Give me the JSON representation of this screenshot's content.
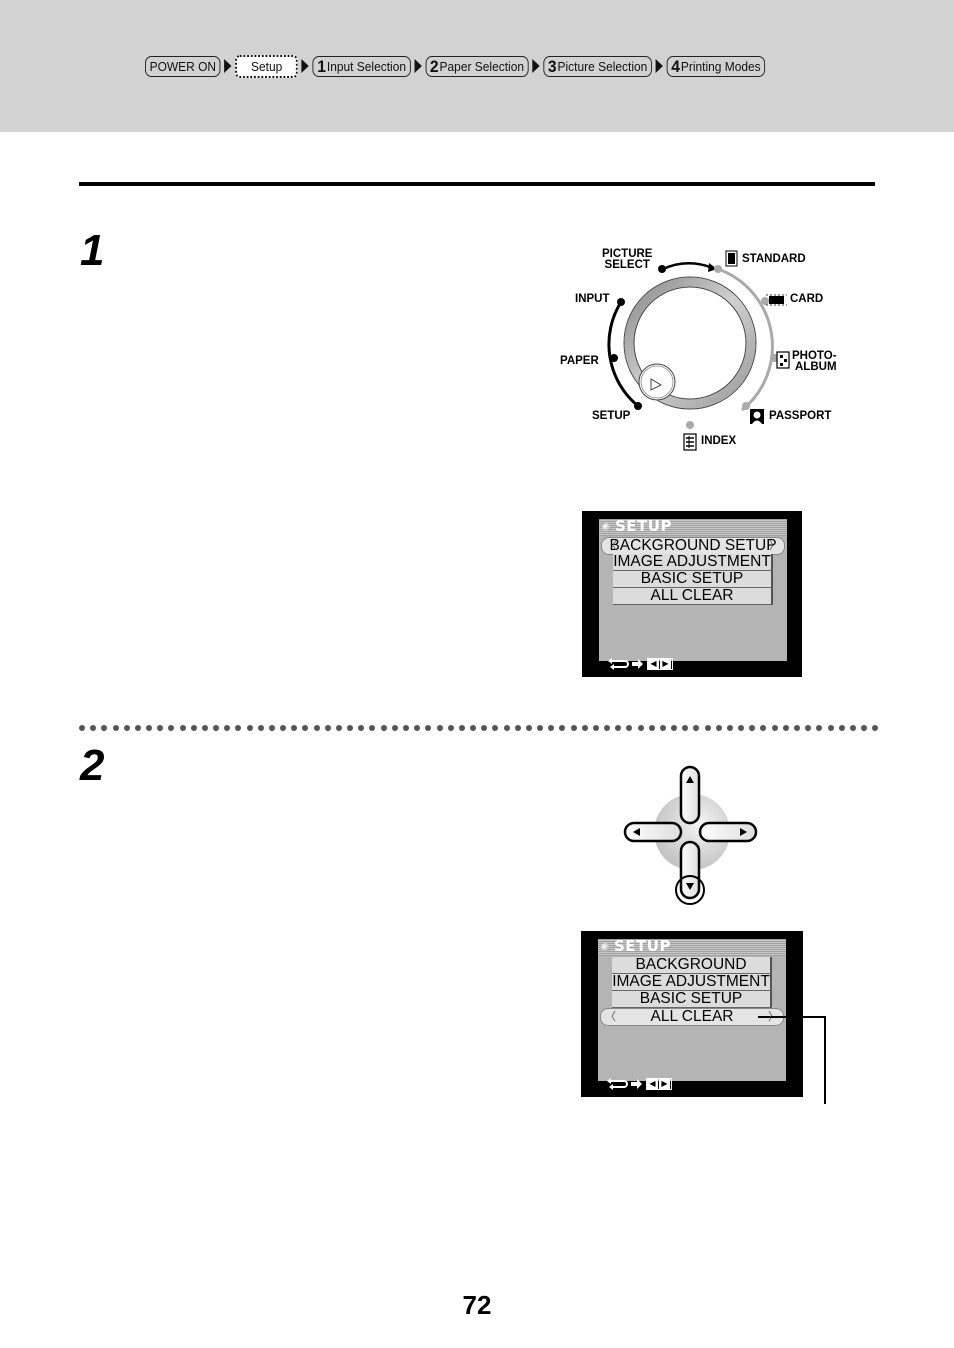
{
  "breadcrumb": {
    "items": [
      {
        "num": "",
        "label": "POWER ON",
        "active": false
      },
      {
        "num": "",
        "label": "Setup",
        "active": true
      },
      {
        "num": "1",
        "label": "Input Selection",
        "active": false
      },
      {
        "num": "2",
        "label": "Paper Selection",
        "active": false
      },
      {
        "num": "3",
        "label": "Picture Selection",
        "active": false
      },
      {
        "num": "4",
        "label": "Printing Modes",
        "active": false
      }
    ]
  },
  "steps": [
    {
      "number": "1"
    },
    {
      "number": "2"
    }
  ],
  "dial": {
    "labels": {
      "picture_select_1": "PICTURE",
      "picture_select_2": "SELECT",
      "input": "INPUT",
      "paper": "PAPER",
      "setup": "SETUP",
      "index": "INDEX",
      "passport": "PASSPORT",
      "photo_album_1": "PHOTO-",
      "photo_album_2": "ALBUM",
      "card": "CARD",
      "standard": "STANDARD"
    },
    "icons": [
      "standard-icon",
      "card-icon",
      "photo-album-icon",
      "passport-icon",
      "index-icon",
      "pointer-triangle-icon"
    ]
  },
  "lcd_screens": [
    {
      "title": "SETUP",
      "items": [
        "BACKGROUND SETUP",
        "IMAGE ADJUSTMENT",
        "BASIC SETUP",
        "ALL CLEAR"
      ],
      "selected_index": 0,
      "footer_icons": [
        "return-icon",
        "arrow-right-icon",
        "left-right-keys-icon"
      ]
    },
    {
      "title": "SETUP",
      "items": [
        "BACKGROUND SETUP",
        "IMAGE ADJUSTMENT",
        "BASIC SETUP",
        "ALL CLEAR"
      ],
      "selected_index": 3,
      "footer_icons": [
        "return-icon",
        "arrow-right-icon",
        "left-right-keys-icon"
      ]
    }
  ],
  "dpad": {
    "highlighted": "down",
    "buttons": [
      "up",
      "left",
      "right",
      "down"
    ]
  },
  "page": {
    "number": "72"
  }
}
